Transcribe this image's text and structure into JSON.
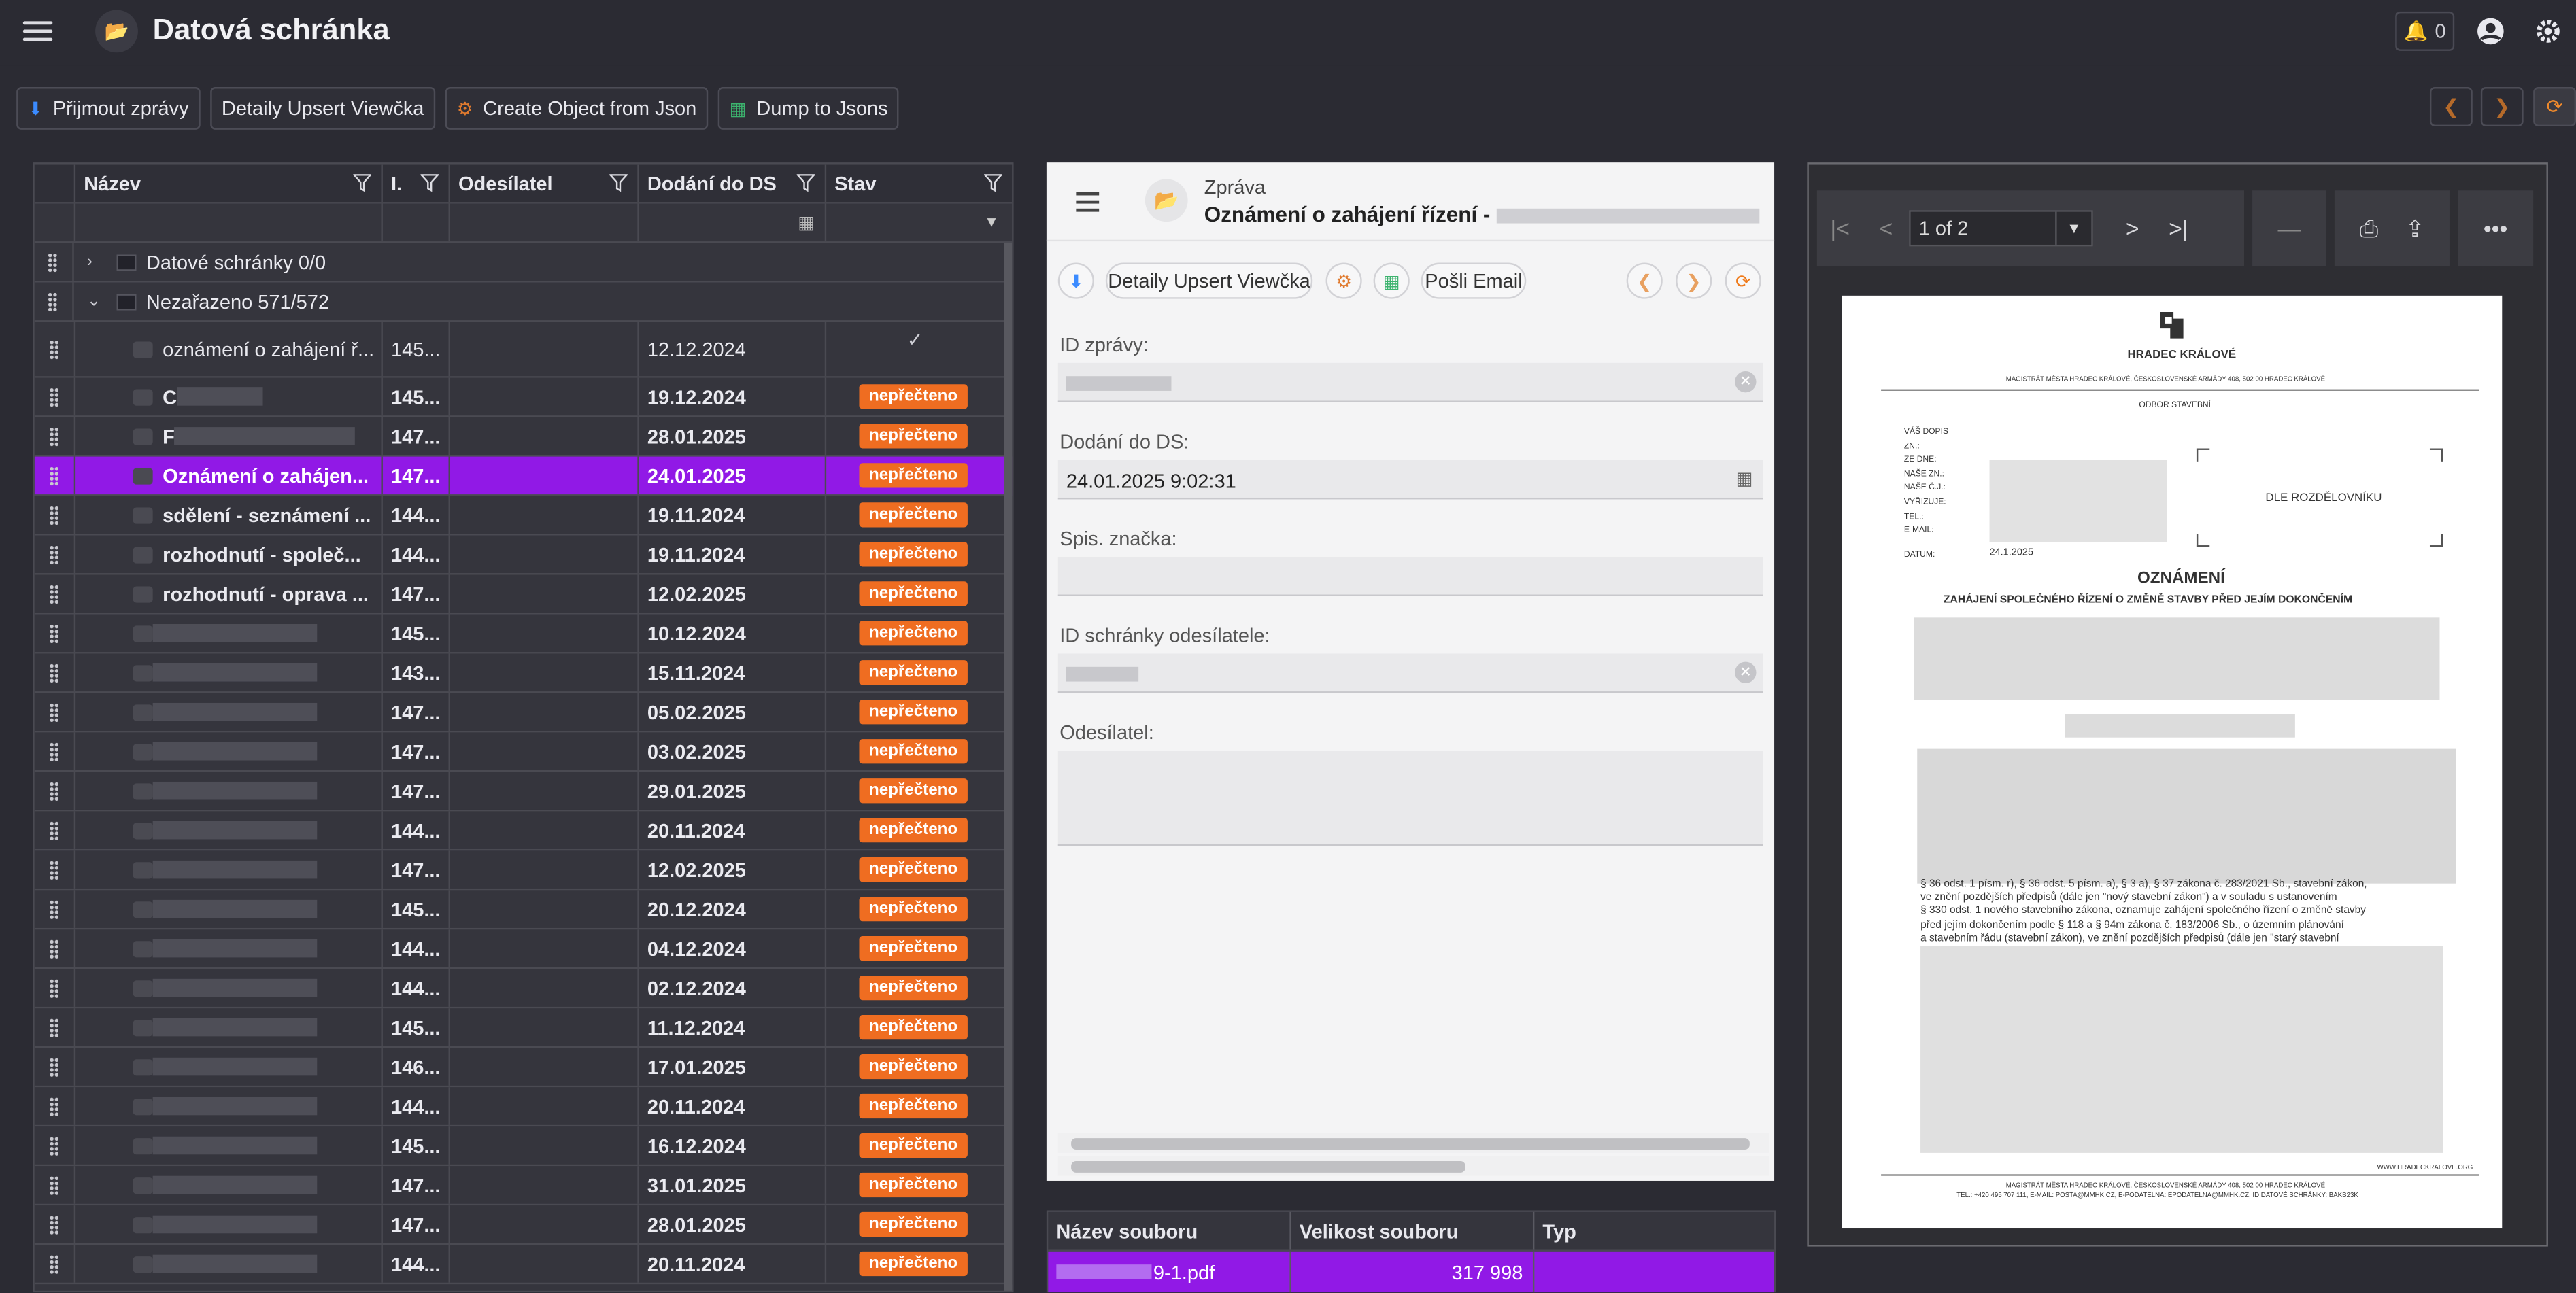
{
  "header": {
    "app_title": "Datová schránka",
    "notification_count": "0",
    "icons": [
      "menu-icon",
      "folder-icon",
      "bell-icon",
      "user-icon",
      "gear-icon"
    ]
  },
  "toolbar": {
    "receive_label": "Přijmout zprávy",
    "details_label": "Detaily Upsert Viewčka",
    "create_label": "Create Object from Json",
    "dump_label": "Dump to Jsons"
  },
  "grid": {
    "columns": [
      "Název",
      "I.",
      "Odesílatel",
      "Dodání do DS",
      "Stav"
    ],
    "groups": [
      {
        "label": "Datové schránky 0/0"
      },
      {
        "label": "Nezařazeno 571/572"
      }
    ],
    "rows": [
      {
        "name": "oznámení o zahájení ř...",
        "id": "145...",
        "date": "12.12.2024",
        "status": "",
        "style": "tall"
      },
      {
        "name": "C",
        "id": "145...",
        "date": "19.12.2024",
        "status": "nepřečteno",
        "style": "bold"
      },
      {
        "name": "F",
        "id": "147...",
        "date": "28.01.2025",
        "status": "nepřečteno",
        "style": "bold"
      },
      {
        "name": "Oznámení o zahájen...",
        "id": "147...",
        "date": "24.01.2025",
        "status": "nepřečteno",
        "style": "sel"
      },
      {
        "name": "sdělení - seznámení ...",
        "id": "144...",
        "date": "19.11.2024",
        "status": "nepřečteno",
        "style": "bold"
      },
      {
        "name": "rozhodnutí - společ...",
        "id": "144...",
        "date": "19.11.2024",
        "status": "nepřečteno",
        "style": "bold"
      },
      {
        "name": "rozhodnutí - oprava ...",
        "id": "147...",
        "date": "12.02.2025",
        "status": "nepřečteno",
        "style": "bold"
      },
      {
        "name": "",
        "id": "145...",
        "date": "10.12.2024",
        "status": "nepřečteno",
        "style": "bold"
      },
      {
        "name": "",
        "id": "143...",
        "date": "15.11.2024",
        "status": "nepřečteno",
        "style": "bold"
      },
      {
        "name": "",
        "id": "147...",
        "date": "05.02.2025",
        "status": "nepřečteno",
        "style": "bold"
      },
      {
        "name": "",
        "id": "147...",
        "date": "03.02.2025",
        "status": "nepřečteno",
        "style": "bold"
      },
      {
        "name": "",
        "id": "147...",
        "date": "29.01.2025",
        "status": "nepřečteno",
        "style": "bold"
      },
      {
        "name": "",
        "id": "144...",
        "date": "20.11.2024",
        "status": "nepřečteno",
        "style": "bold"
      },
      {
        "name": "",
        "id": "147...",
        "date": "12.02.2025",
        "status": "nepřečteno",
        "style": "bold"
      },
      {
        "name": "",
        "id": "145...",
        "date": "20.12.2024",
        "status": "nepřečteno",
        "style": "bold"
      },
      {
        "name": "",
        "id": "144...",
        "date": "04.12.2024",
        "status": "nepřečteno",
        "style": "bold"
      },
      {
        "name": "",
        "id": "144...",
        "date": "02.12.2024",
        "status": "nepřečteno",
        "style": "bold"
      },
      {
        "name": "",
        "id": "145...",
        "date": "11.12.2024",
        "status": "nepřečteno",
        "style": "bold"
      },
      {
        "name": "",
        "id": "146...",
        "date": "17.01.2025",
        "status": "nepřečteno",
        "style": "bold"
      },
      {
        "name": "",
        "id": "144...",
        "date": "20.11.2024",
        "status": "nepřečteno",
        "style": "bold"
      },
      {
        "name": "",
        "id": "145...",
        "date": "16.12.2024",
        "status": "nepřečteno",
        "style": "bold"
      },
      {
        "name": "",
        "id": "147...",
        "date": "31.01.2025",
        "status": "nepřečteno",
        "style": "bold"
      },
      {
        "name": "",
        "id": "147...",
        "date": "28.01.2025",
        "status": "nepřečteno",
        "style": "bold"
      },
      {
        "name": "",
        "id": "144...",
        "date": "20.11.2024",
        "status": "nepřečteno",
        "style": "bold"
      }
    ]
  },
  "message": {
    "subtitle": "Zpráva",
    "title": "Oznámení o zahájení řízení -",
    "details_label": "Detaily Upsert Viewčka",
    "email_label": "Pošli Email",
    "fields": {
      "id_label": "ID zprávy:",
      "delivery_label": "Dodání do DS:",
      "delivery_value": "24.01.2025 9:02:31",
      "file_label": "Spis. značka:",
      "sender_box_label": "ID schránky odesílatele:",
      "sender_label": "Odesílatel:"
    }
  },
  "attachments": {
    "columns": [
      "Název souboru",
      "Velikost souboru",
      "Typ"
    ],
    "row": {
      "name": "9-1.pdf",
      "size": "317 998",
      "type": ""
    }
  },
  "pdf": {
    "page_indicator": "1 of 2",
    "doc": {
      "city": "HRADEC KRÁLOVÉ",
      "office": "MAGISTRÁT MĚSTA HRADEC KRÁLOVÉ, ČESKOSLOVENSKÉ ARMÁDY 408, 502 00 HRADEC KRÁLOVÉ",
      "dept": "ODBOR STAVEBNÍ",
      "left_labels": [
        "VÁŠ DOPIS",
        "ZN.:",
        "ZE DNE:",
        "NAŠE ZN.:",
        "NAŠE Č.J.:",
        "VYŘIZUJE:",
        "TEL.:",
        "E-MAIL:"
      ],
      "date_label": "DATUM:",
      "date_value": "24.1.2025",
      "recipient": "DLE ROZDĚLOVNÍKU",
      "heading": "OZNÁMENÍ",
      "subheading": "ZAHÁJENÍ SPOLEČNÉHO ŘÍZENÍ O ZMĚNĚ STAVBY PŘED JEJÍM DOKONČENÍM",
      "body_lines": [
        "§ 36 odst. 1 písm. r), § 36 odst. 5 písm. a), § 3 a), § 37 zákona č. 283/2021 Sb., stavební zákon,",
        "ve znění pozdějších předpisů (dále jen \"nový stavební zákon\") a v souladu s ustanovením",
        "§ 330 odst. 1 nového stavebního zákona, oznamuje zahájení společného řízení o změně stavby",
        "před jejím dokončením podle § 118 a § 94m zákona č. 183/2006 Sb., o územním plánování",
        "a stavebním řádu (stavební zákon), ve znění pozdějších předpisů (dále jen \"starý stavební"
      ],
      "website": "WWW.HRADECKRALOVE.ORG",
      "footer1": "MAGISTRÁT MĚSTA HRADEC KRÁLOVÉ, ČESKOSLOVENSKÉ ARMÁDY 408, 502 00 HRADEC KRÁLOVÉ",
      "footer2": "TEL.: +420 495 707 111, E-MAIL: POSTA@MMHK.CZ, E-PODATELNA: EPODATELNA@MMHK.CZ, ID DATOVÉ SCHRÁNKY: BAKB23K"
    }
  },
  "colors": {
    "background": "#2b2b33",
    "selected": "#9119e6",
    "badge": "#ef6d21",
    "accent_orange": "#b56a2a"
  }
}
